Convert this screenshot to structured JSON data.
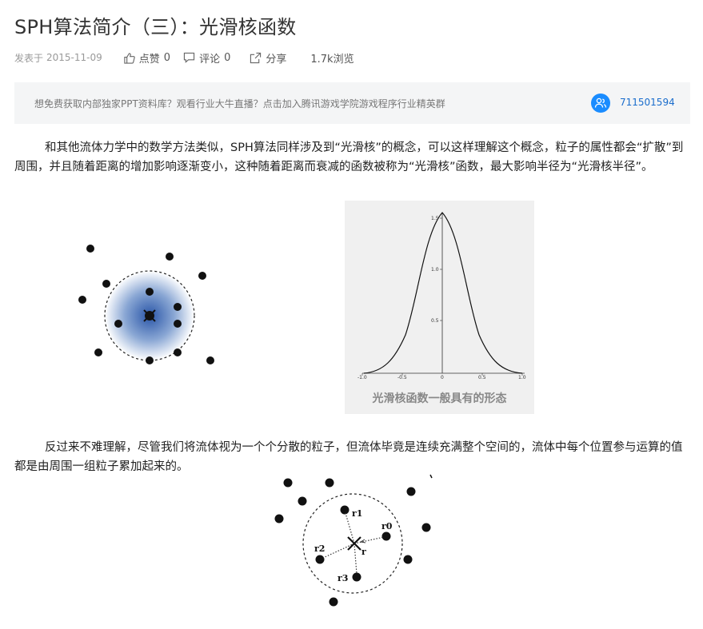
{
  "article": {
    "title": "SPH算法简介（三）：光滑核函数",
    "date_label": "发表于",
    "date": "2015-11-09",
    "like_label": "点赞",
    "like_count": "0",
    "comment_label": "评论",
    "comment_count": "0",
    "share_label": "分享",
    "views": "1.7k浏览"
  },
  "banner": {
    "text": "想免费获取内部独家PPT资料库？观看行业大牛直播？点击加入腾讯游戏学院游戏程序行业精英群",
    "qq": "711501594",
    "icon": "group-icon",
    "accent": "#1a8cff"
  },
  "content": {
    "paragraph1": "和其他流体力学中的数学方法类似，SPH算法同样涉及到“光滑核”的概念，可以这样理解这个概念，粒子的属性都会“扩散”到周围，并且随着距离的增加影响逐渐变小，这种随着距离而衰减的函数被称为“光滑核”函数，最大影响半径为“光滑核半径”。",
    "paragraph2": "反过来不难理解，尽管我们将流体视为一个个分散的粒子，但流体毕竟是连续充满整个空间的，流体中每个位置参与运算的值都是由周围一组粒子累加起来的。"
  },
  "figure_graph": {
    "caption": "光滑核函数一般具有的形态",
    "x_ticks": [
      "-1.0",
      "-0.5",
      "0",
      "0.5",
      "1.0"
    ],
    "y_ticks": [
      "1.5",
      "1.0",
      "0.5"
    ]
  },
  "figure_vectors": {
    "labels": [
      "r1",
      "r0",
      "r2",
      "r",
      "r3"
    ]
  }
}
